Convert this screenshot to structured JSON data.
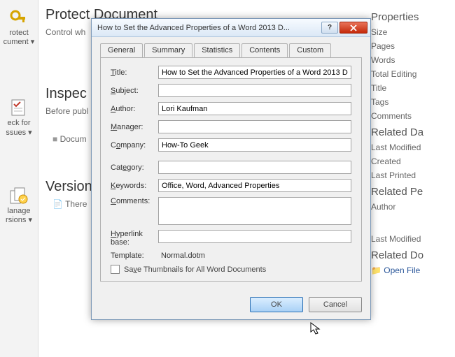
{
  "ribbon": {
    "protect": {
      "line1": "rotect",
      "line2": "cument"
    },
    "protect_title": "Protect Document",
    "protect_sub": "Control wh",
    "check": {
      "line1": "eck for",
      "line2": "ssues"
    },
    "inspect_title": "Inspec",
    "inspect_sub": "Before publ",
    "inspect_bullet": "Docum",
    "manage": {
      "line1": "lanage",
      "line2": "rsions"
    },
    "versions_title": "Version",
    "versions_bullet": "There"
  },
  "dialog": {
    "title": "How to Set the Advanced Properties of a Word 2013 D...",
    "tabs": [
      "General",
      "Summary",
      "Statistics",
      "Contents",
      "Custom"
    ],
    "fields": {
      "title_label": "Title:",
      "title_value": "How to Set the Advanced Properties of a Word 2013 D",
      "subject_label": "Subject:",
      "subject_value": "",
      "author_label": "Author:",
      "author_value": "Lori Kaufman",
      "manager_label": "Manager:",
      "manager_value": "",
      "company_label": "Company:",
      "company_value": "How-To Geek",
      "category_label": "Category:",
      "category_value": "",
      "keywords_label": "Keywords:",
      "keywords_value": "Office, Word, Advanced Properties",
      "comments_label": "Comments:",
      "comments_value": "",
      "hyperlink_label1": "Hyperlink",
      "hyperlink_label2": "base:",
      "hyperlink_value": "",
      "template_label": "Template:",
      "template_value": "Normal.dotm",
      "savethumb_label": "Save Thumbnails for All Word Documents"
    },
    "buttons": {
      "ok": "OK",
      "cancel": "Cancel"
    }
  },
  "props": {
    "head1": "Properties",
    "rows1": [
      "Size",
      "Pages",
      "Words",
      "Total Editing",
      "Title",
      "Tags",
      "Comments"
    ],
    "head2": "Related Da",
    "rows2": [
      "Last Modified",
      "Created",
      "Last Printed"
    ],
    "head3": "Related Pe",
    "rows3": [
      "Author"
    ],
    "rows4": [
      "Last Modified"
    ],
    "head4": "Related Do",
    "openfile": "Open File"
  }
}
